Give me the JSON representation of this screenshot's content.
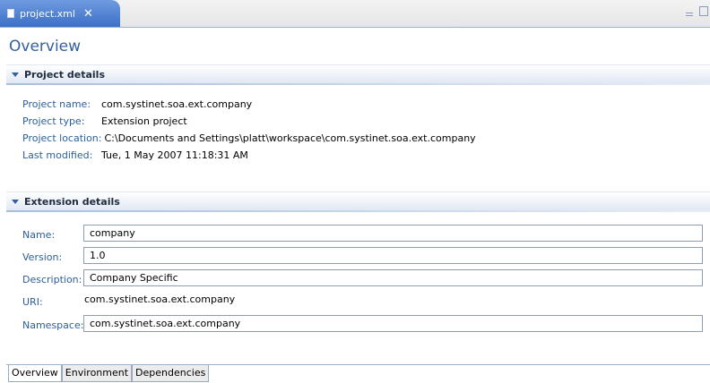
{
  "editor_tab": {
    "title": "project.xml",
    "close": "✕"
  },
  "page_title": "Overview",
  "project_section": {
    "title": "Project details",
    "rows": [
      {
        "label": "Project name:",
        "value": "com.systinet.soa.ext.company"
      },
      {
        "label": "Project type:",
        "value": "Extension project"
      },
      {
        "label": "Project location:",
        "value": "C:\\Documents and Settings\\platt\\workspace\\com.systinet.soa.ext.company"
      },
      {
        "label": "Last modified:",
        "value": "Tue, 1 May 2007 11:18:31 AM"
      }
    ]
  },
  "extension_section": {
    "title": "Extension details",
    "name_label": "Name:",
    "name_value": "company",
    "version_label": "Version:",
    "version_value": "1.0",
    "description_label": "Description:",
    "description_value": "Company Specific",
    "uri_label": "URI:",
    "uri_value": "com.systinet.soa.ext.company",
    "namespace_label": "Namespace:",
    "namespace_value": "com.systinet.soa.ext.company"
  },
  "bottom_tabs": [
    "Overview",
    "Environment",
    "Dependencies"
  ],
  "icons": {
    "file": "xml-file-icon",
    "close": "close-icon",
    "section_toggle": "expand-triangle-icon"
  },
  "colors": {
    "tab_blue": "#3c6fc7",
    "label_blue": "#2d5e9a",
    "title_blue": "#35609e"
  }
}
